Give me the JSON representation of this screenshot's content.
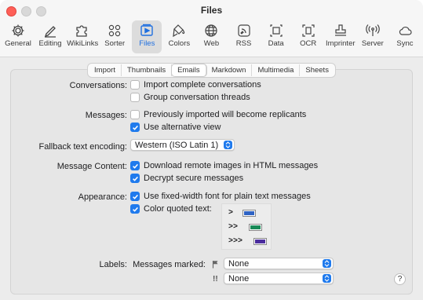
{
  "window": {
    "title": "Files"
  },
  "toolbar": [
    {
      "label": "General",
      "icon": "gear-icon"
    },
    {
      "label": "Editing",
      "icon": "pencil-icon"
    },
    {
      "label": "WikiLinks",
      "icon": "puzzle-icon"
    },
    {
      "label": "Sorter",
      "icon": "sorter-icon"
    },
    {
      "label": "Files",
      "icon": "files-icon",
      "active": true
    },
    {
      "label": "Colors",
      "icon": "paint-icon"
    },
    {
      "label": "Web",
      "icon": "globe-icon"
    },
    {
      "label": "RSS",
      "icon": "rss-icon"
    },
    {
      "label": "Data",
      "icon": "data-icon"
    },
    {
      "label": "OCR",
      "icon": "ocr-icon"
    },
    {
      "label": "Imprinter",
      "icon": "stamp-icon"
    },
    {
      "label": "Server",
      "icon": "antenna-icon"
    },
    {
      "label": "Sync",
      "icon": "cloud-icon"
    }
  ],
  "tabs": [
    {
      "label": "Import"
    },
    {
      "label": "Thumbnails"
    },
    {
      "label": "Emails",
      "active": true
    },
    {
      "label": "Markdown"
    },
    {
      "label": "Multimedia"
    },
    {
      "label": "Sheets"
    }
  ],
  "conversations": {
    "label": "Conversations:",
    "import_complete": {
      "label": "Import complete conversations",
      "checked": false
    },
    "group_threads": {
      "label": "Group conversation threads",
      "checked": false
    }
  },
  "messages": {
    "label": "Messages:",
    "replicants": {
      "label": "Previously imported will become replicants",
      "checked": false
    },
    "alternative_view": {
      "label": "Use alternative view",
      "checked": true
    }
  },
  "fallback": {
    "label": "Fallback text encoding:",
    "value": "Western (ISO Latin 1)"
  },
  "message_content": {
    "label": "Message Content:",
    "download_images": {
      "label": "Download remote images in HTML messages",
      "checked": true
    },
    "decrypt": {
      "label": "Decrypt secure messages",
      "checked": true
    }
  },
  "appearance": {
    "label": "Appearance:",
    "fixed_width": {
      "label": "Use fixed-width font for plain text messages",
      "checked": true
    },
    "color_quoted": {
      "label": "Color quoted text:",
      "checked": true
    },
    "quote_levels": [
      {
        "marker": ">",
        "color": "#2f63c4"
      },
      {
        "marker": ">>",
        "color": "#188a57"
      },
      {
        "marker": ">>>",
        "color": "#4b2d9e"
      }
    ]
  },
  "labels": {
    "label": "Labels:",
    "messages_marked": "Messages marked:",
    "flag_value": "None",
    "priority_marker": "!!",
    "priority_value": "None"
  },
  "help": {
    "label": "?"
  }
}
